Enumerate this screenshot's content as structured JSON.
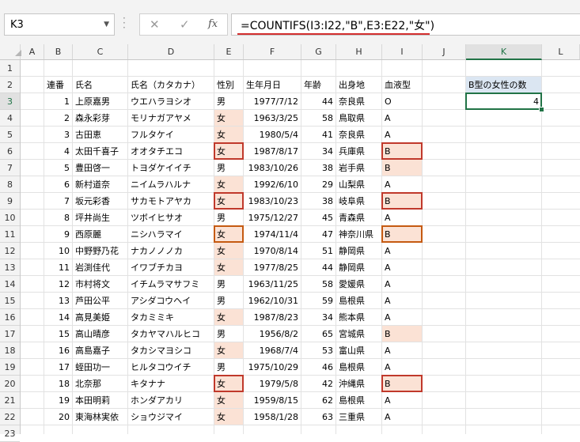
{
  "namebox": {
    "value": "K3"
  },
  "formula_bar": {
    "cancel_icon": "✕",
    "enter_icon": "✓",
    "fx_label": "fx",
    "formula": "=COUNTIFS(I3:I22,\"B\",E3:E22,\"女\")"
  },
  "columns": [
    "A",
    "B",
    "C",
    "D",
    "E",
    "F",
    "G",
    "H",
    "I",
    "J",
    "K",
    "L"
  ],
  "headers": {
    "no": "連番",
    "name": "氏名",
    "kana": "氏名（カタカナ）",
    "sex": "性別",
    "birth": "生年月日",
    "age": "年齢",
    "pref": "出身地",
    "blood": "血液型"
  },
  "summary": {
    "label": "B型の女性の数",
    "value": "4"
  },
  "rows": [
    {
      "no": "1",
      "name": "上原嘉男",
      "kana": "ウエハラヨシオ",
      "sex": "男",
      "birth": "1977/7/12",
      "age": "44",
      "pref": "奈良県",
      "blood": "O"
    },
    {
      "no": "2",
      "name": "森永彩芽",
      "kana": "モリナガアヤメ",
      "sex": "女",
      "birth": "1963/3/25",
      "age": "58",
      "pref": "鳥取県",
      "blood": "A"
    },
    {
      "no": "3",
      "name": "古田恵",
      "kana": "フルタケイ",
      "sex": "女",
      "birth": "1980/5/4",
      "age": "41",
      "pref": "奈良県",
      "blood": "A"
    },
    {
      "no": "4",
      "name": "太田千喜子",
      "kana": "オオタチエコ",
      "sex": "女",
      "birth": "1987/8/17",
      "age": "34",
      "pref": "兵庫県",
      "blood": "B"
    },
    {
      "no": "5",
      "name": "豊田啓一",
      "kana": "トヨダケイイチ",
      "sex": "男",
      "birth": "1983/10/26",
      "age": "38",
      "pref": "岩手県",
      "blood": "B"
    },
    {
      "no": "6",
      "name": "新村道奈",
      "kana": "ニイムラハルナ",
      "sex": "女",
      "birth": "1992/6/10",
      "age": "29",
      "pref": "山梨県",
      "blood": "A"
    },
    {
      "no": "7",
      "name": "坂元彩香",
      "kana": "サカモトアヤカ",
      "sex": "女",
      "birth": "1983/10/23",
      "age": "38",
      "pref": "岐阜県",
      "blood": "B"
    },
    {
      "no": "8",
      "name": "坪井尚生",
      "kana": "ツボイヒサオ",
      "sex": "男",
      "birth": "1975/12/27",
      "age": "45",
      "pref": "青森県",
      "blood": "A"
    },
    {
      "no": "9",
      "name": "西原麗",
      "kana": "ニシハラマイ",
      "sex": "女",
      "birth": "1974/11/4",
      "age": "47",
      "pref": "神奈川県",
      "blood": "B"
    },
    {
      "no": "10",
      "name": "中野野乃花",
      "kana": "ナカノノノカ",
      "sex": "女",
      "birth": "1970/8/14",
      "age": "51",
      "pref": "静岡県",
      "blood": "A"
    },
    {
      "no": "11",
      "name": "岩渕佳代",
      "kana": "イワブチカヨ",
      "sex": "女",
      "birth": "1977/8/25",
      "age": "44",
      "pref": "静岡県",
      "blood": "A"
    },
    {
      "no": "12",
      "name": "市村将文",
      "kana": "イチムラマサフミ",
      "sex": "男",
      "birth": "1963/11/25",
      "age": "58",
      "pref": "愛媛県",
      "blood": "A"
    },
    {
      "no": "13",
      "name": "芦田公平",
      "kana": "アシダコウヘイ",
      "sex": "男",
      "birth": "1962/10/31",
      "age": "59",
      "pref": "島根県",
      "blood": "A"
    },
    {
      "no": "14",
      "name": "高見美姫",
      "kana": "タカミミキ",
      "sex": "女",
      "birth": "1987/8/23",
      "age": "34",
      "pref": "熊本県",
      "blood": "A"
    },
    {
      "no": "15",
      "name": "高山晴彦",
      "kana": "タカヤマハルヒコ",
      "sex": "男",
      "birth": "1956/8/2",
      "age": "65",
      "pref": "宮城県",
      "blood": "B"
    },
    {
      "no": "16",
      "name": "高島嘉子",
      "kana": "タカシマヨシコ",
      "sex": "女",
      "birth": "1968/7/4",
      "age": "53",
      "pref": "富山県",
      "blood": "A"
    },
    {
      "no": "17",
      "name": "蛭田功一",
      "kana": "ヒルタコウイチ",
      "sex": "男",
      "birth": "1975/10/29",
      "age": "46",
      "pref": "島根県",
      "blood": "A"
    },
    {
      "no": "18",
      "name": "北奈那",
      "kana": "キタナナ",
      "sex": "女",
      "birth": "1979/5/8",
      "age": "42",
      "pref": "沖縄県",
      "blood": "B"
    },
    {
      "no": "19",
      "name": "本田明莉",
      "kana": "ホンダアカリ",
      "sex": "女",
      "birth": "1959/8/15",
      "age": "62",
      "pref": "島根県",
      "blood": "A"
    },
    {
      "no": "20",
      "name": "東海林実依",
      "kana": "ショウジマイ",
      "sex": "女",
      "birth": "1958/1/28",
      "age": "63",
      "pref": "三重県",
      "blood": "A"
    }
  ],
  "colors": {
    "female_fill": "#fbe2d5",
    "b_fill": "#fbe2d5",
    "match_border": "#c0392b",
    "active_green": "#217346",
    "formula_underline": "#d32f2f"
  }
}
